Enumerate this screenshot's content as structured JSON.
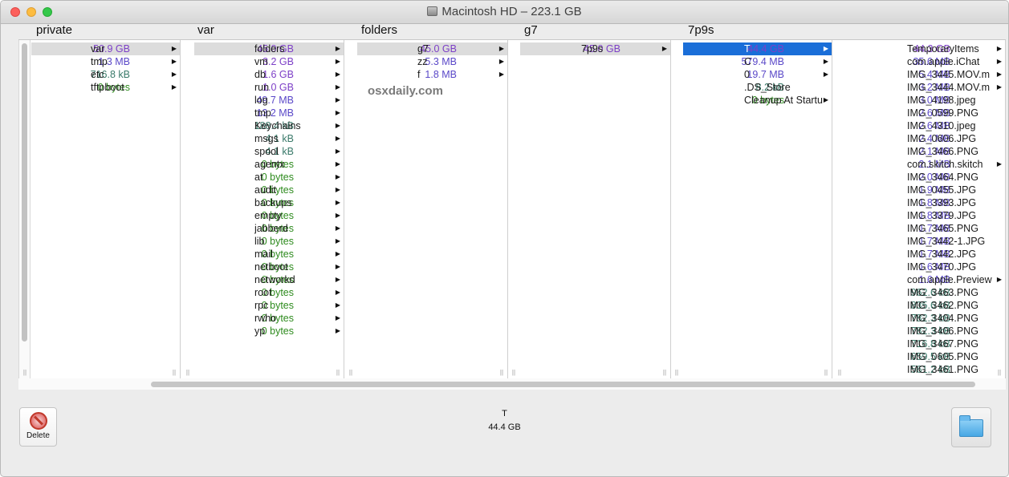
{
  "window": {
    "title": "Macintosh HD – 223.1 GB"
  },
  "colors": {
    "gb": "#7d3fc7",
    "mb": "#5a48c8",
    "kb": "#3a7a6a",
    "bytes": "#2e8b1e",
    "selection_blue": "#1a6ed8",
    "selection_grey": "#dcdcdc"
  },
  "columns": [
    {
      "header": "private",
      "rows": [
        {
          "size": "50.9 GB",
          "unit": "gb",
          "name": "var",
          "arrow": true,
          "selected": "grey"
        },
        {
          "size": "1.3 MB",
          "unit": "mb",
          "name": "tmp",
          "arrow": true
        },
        {
          "size": "716.8 kB",
          "unit": "kb",
          "name": "etc",
          "arrow": true
        },
        {
          "size": "0 bytes",
          "unit": "bytes",
          "name": "tftpboot",
          "arrow": true
        }
      ]
    },
    {
      "header": "var",
      "rows": [
        {
          "size": "45.0 GB",
          "unit": "gb",
          "name": "folders",
          "arrow": true,
          "selected": "grey"
        },
        {
          "size": "3.2 GB",
          "unit": "gb",
          "name": "vm",
          "arrow": true
        },
        {
          "size": "1.6 GB",
          "unit": "gb",
          "name": "db",
          "arrow": true
        },
        {
          "size": "1.0 GB",
          "unit": "gb",
          "name": "run",
          "arrow": true
        },
        {
          "size": "49.7 MB",
          "unit": "mb",
          "name": "log",
          "arrow": true
        },
        {
          "size": "13.2 MB",
          "unit": "mb",
          "name": "tmp",
          "arrow": true
        },
        {
          "size": "188.4 kB",
          "unit": "kb",
          "name": "Keychains",
          "arrow": true
        },
        {
          "size": "4.1 kB",
          "unit": "kb",
          "name": "msgs",
          "arrow": true
        },
        {
          "size": "4.1 kB",
          "unit": "kb",
          "name": "spool",
          "arrow": true
        },
        {
          "size": "0 bytes",
          "unit": "bytes",
          "name": "agentx",
          "arrow": true
        },
        {
          "size": "0 bytes",
          "unit": "bytes",
          "name": "at",
          "arrow": true
        },
        {
          "size": "0 bytes",
          "unit": "bytes",
          "name": "audit",
          "arrow": true
        },
        {
          "size": "0 bytes",
          "unit": "bytes",
          "name": "backups",
          "arrow": true
        },
        {
          "size": "0 bytes",
          "unit": "bytes",
          "name": "empty",
          "arrow": true
        },
        {
          "size": "0 bytes",
          "unit": "bytes",
          "name": "jabberd",
          "arrow": true
        },
        {
          "size": "0 bytes",
          "unit": "bytes",
          "name": "lib",
          "arrow": true
        },
        {
          "size": "0 bytes",
          "unit": "bytes",
          "name": "mail",
          "arrow": true
        },
        {
          "size": "0 bytes",
          "unit": "bytes",
          "name": "netboot",
          "arrow": true
        },
        {
          "size": "0 bytes",
          "unit": "bytes",
          "name": "networkd",
          "arrow": true
        },
        {
          "size": "0 bytes",
          "unit": "bytes",
          "name": "root",
          "arrow": true
        },
        {
          "size": "0 bytes",
          "unit": "bytes",
          "name": "rpc",
          "arrow": true
        },
        {
          "size": "0 bytes",
          "unit": "bytes",
          "name": "rwho",
          "arrow": true
        },
        {
          "size": "0 bytes",
          "unit": "bytes",
          "name": "yp",
          "arrow": true
        }
      ]
    },
    {
      "header": "folders",
      "watermark": "osxdaily.com",
      "rows": [
        {
          "size": "45.0 GB",
          "unit": "gb",
          "name": "g7",
          "arrow": true,
          "selected": "grey"
        },
        {
          "size": "5.3 MB",
          "unit": "mb",
          "name": "zz",
          "arrow": true
        },
        {
          "size": "1.8 MB",
          "unit": "mb",
          "name": "f",
          "arrow": true
        }
      ]
    },
    {
      "header": "g7",
      "rows": [
        {
          "size": "45.0 GB",
          "unit": "gb",
          "name": "7p9s",
          "arrow": true,
          "selected": "grey"
        }
      ]
    },
    {
      "header": "7p9s",
      "rows": [
        {
          "size": "44.4 GB",
          "unit": "gb",
          "name": "T",
          "arrow": true,
          "selected": "blue"
        },
        {
          "size": "579.4 MB",
          "unit": "mb",
          "name": "C",
          "arrow": true
        },
        {
          "size": "19.7 MB",
          "unit": "mb",
          "name": "0",
          "arrow": true
        },
        {
          "size": "8.2 kB",
          "unit": "kb",
          "name": ".DS_Store",
          "arrow": false
        },
        {
          "size": "0 bytes",
          "unit": "bytes",
          "name": "Cleanup At Startup",
          "arrow": true
        }
      ]
    },
    {
      "header": "",
      "rows": [
        {
          "size": "44.3 GB",
          "unit": "gb",
          "name": "TemporaryItems",
          "arrow": true
        },
        {
          "size": "35.6 MB",
          "unit": "mb",
          "name": "com.apple.iChat",
          "arrow": true
        },
        {
          "size": "5.4 MB",
          "unit": "mb",
          "name": "IMG_3445.MOV.m",
          "arrow": true
        },
        {
          "size": "3.2 MB",
          "unit": "mb",
          "name": "IMG_3444.MOV.m",
          "arrow": true
        },
        {
          "size": "3.0 MB",
          "unit": "mb",
          "name": "IMG_4198.jpeg",
          "arrow": false
        },
        {
          "size": "2.6 MB",
          "unit": "mb",
          "name": "IMG_0599.PNG",
          "arrow": false
        },
        {
          "size": "2.6 MB",
          "unit": "mb",
          "name": "IMG_4310.jpeg",
          "arrow": false
        },
        {
          "size": "2.4 MB",
          "unit": "mb",
          "name": "IMG_0606.JPG",
          "arrow": false
        },
        {
          "size": "2.1 MB",
          "unit": "mb",
          "name": "IMG_3466.PNG",
          "arrow": false
        },
        {
          "size": "2.1 MB",
          "unit": "mb",
          "name": "com.skitch.skitch",
          "arrow": true
        },
        {
          "size": "2.0 MB",
          "unit": "mb",
          "name": "IMG_3464.PNG",
          "arrow": false
        },
        {
          "size": "1.9 MB",
          "unit": "mb",
          "name": "IMG_0455.JPG",
          "arrow": false
        },
        {
          "size": "1.8 MB",
          "unit": "mb",
          "name": "IMG_3393.JPG",
          "arrow": false
        },
        {
          "size": "1.8 MB",
          "unit": "mb",
          "name": "IMG_3379.JPG",
          "arrow": false
        },
        {
          "size": "1.7 MB",
          "unit": "mb",
          "name": "IMG_3465.PNG",
          "arrow": false
        },
        {
          "size": "1.7 MB",
          "unit": "mb",
          "name": "IMG_3442-1.JPG",
          "arrow": false
        },
        {
          "size": "1.7 MB",
          "unit": "mb",
          "name": "IMG_3442.JPG",
          "arrow": false
        },
        {
          "size": "1.6 MB",
          "unit": "mb",
          "name": "IMG_3470.JPG",
          "arrow": false
        },
        {
          "size": "1.6 MB",
          "unit": "mb",
          "name": "com.apple.Preview",
          "arrow": true
        },
        {
          "size": "962.6 kB",
          "unit": "kb",
          "name": "IMG_3463.PNG",
          "arrow": false
        },
        {
          "size": "835.6 kB",
          "unit": "kb",
          "name": "IMG_3462.PNG",
          "arrow": false
        },
        {
          "size": "782.3 kB",
          "unit": "kb",
          "name": "IMG_3404.PNG",
          "arrow": false
        },
        {
          "size": "782.3 kB",
          "unit": "kb",
          "name": "IMG_3406.PNG",
          "arrow": false
        },
        {
          "size": "716.8 kB",
          "unit": "kb",
          "name": "IMG_3467.PNG",
          "arrow": false
        },
        {
          "size": "659.5 kB",
          "unit": "kb",
          "name": "IMG_0605.PNG",
          "arrow": false
        },
        {
          "size": "561.2 kB",
          "unit": "kb",
          "name": "IMG_3461.PNG",
          "arrow": false
        }
      ]
    }
  ],
  "toolbar": {
    "delete_label": "Delete"
  },
  "info": {
    "selected_name": "T",
    "selected_size": "44.4 GB"
  },
  "icons": {
    "disk": "hard-disk-icon",
    "delete": "delete-icon",
    "folder": "folder-icon",
    "arrow": "▶"
  }
}
